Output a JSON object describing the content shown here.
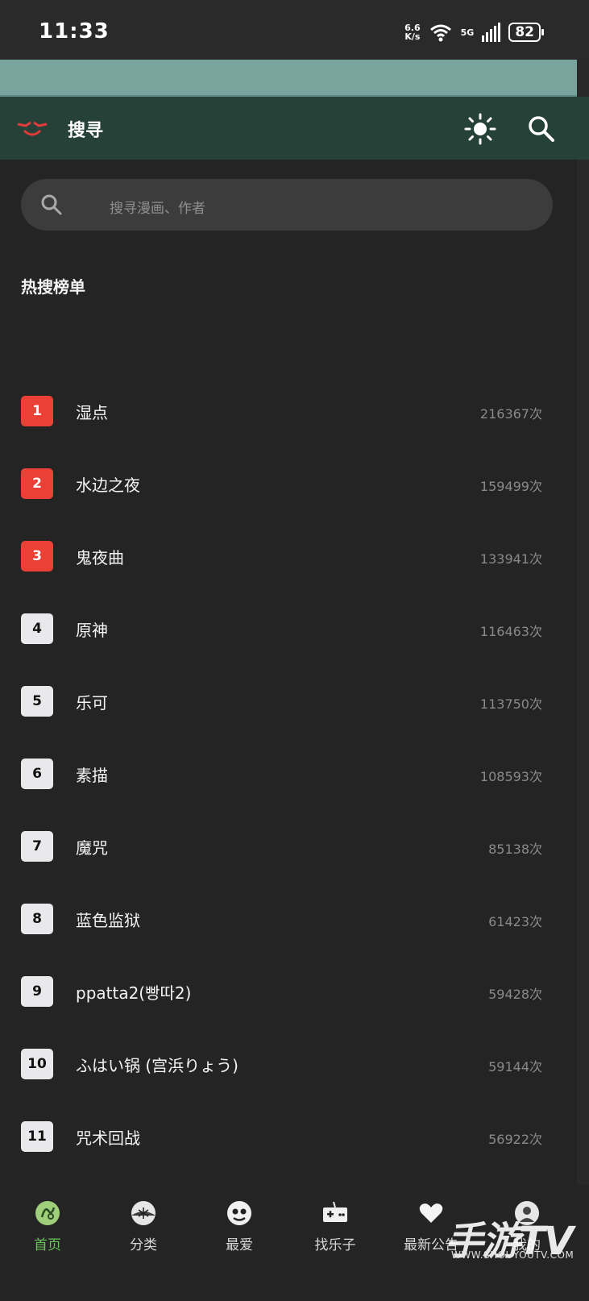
{
  "status_bar": {
    "time": "11:33",
    "net_speed_value": "6.6",
    "net_speed_unit": "K/s",
    "network": "5G",
    "battery": "82"
  },
  "top_bar": {
    "title": "搜寻",
    "logo_icon": "smile-face-icon",
    "theme_icon": "sun-icon",
    "search_icon": "search-icon",
    "colors": {
      "bar": "#264238",
      "banner": "#79a49e"
    }
  },
  "search": {
    "placeholder": "搜寻漫画、作者"
  },
  "hot_list": {
    "title": "热搜榜单",
    "items": [
      {
        "rank": "1",
        "name": "湿点",
        "count": "216367次"
      },
      {
        "rank": "2",
        "name": "水边之夜",
        "count": "159499次"
      },
      {
        "rank": "3",
        "name": "鬼夜曲",
        "count": "133941次"
      },
      {
        "rank": "4",
        "name": "原神",
        "count": "116463次"
      },
      {
        "rank": "5",
        "name": "乐可",
        "count": "113750次"
      },
      {
        "rank": "6",
        "name": "素描",
        "count": "108593次"
      },
      {
        "rank": "7",
        "name": "魔咒",
        "count": "85138次"
      },
      {
        "rank": "8",
        "name": "蓝色监狱",
        "count": "61423次"
      },
      {
        "rank": "9",
        "name": "ppatta2(빵따2)",
        "count": "59428次"
      },
      {
        "rank": "10",
        "name": "ふはい锅 (宫浜りょう)",
        "count": "59144次"
      },
      {
        "rank": "11",
        "name": "咒术回战",
        "count": "56922次"
      }
    ],
    "colors": {
      "top3": "#ea4035",
      "normal": "#e9e9ec"
    }
  },
  "bottom_nav": {
    "items": [
      {
        "label": "首页",
        "icon": "home-icon",
        "active": true
      },
      {
        "label": "分类",
        "icon": "category-icon",
        "active": false
      },
      {
        "label": "最爱",
        "icon": "favorite-icon",
        "active": false
      },
      {
        "label": "找乐子",
        "icon": "gamepad-icon",
        "active": false
      },
      {
        "label": "最新公告",
        "icon": "heart-icon",
        "active": false
      },
      {
        "label": "我的",
        "icon": "profile-icon",
        "active": false
      }
    ],
    "active_color": "#6ac35c"
  },
  "watermark": {
    "text": "手游TV",
    "url": "WWW.SHOUYOUTV.COM"
  }
}
